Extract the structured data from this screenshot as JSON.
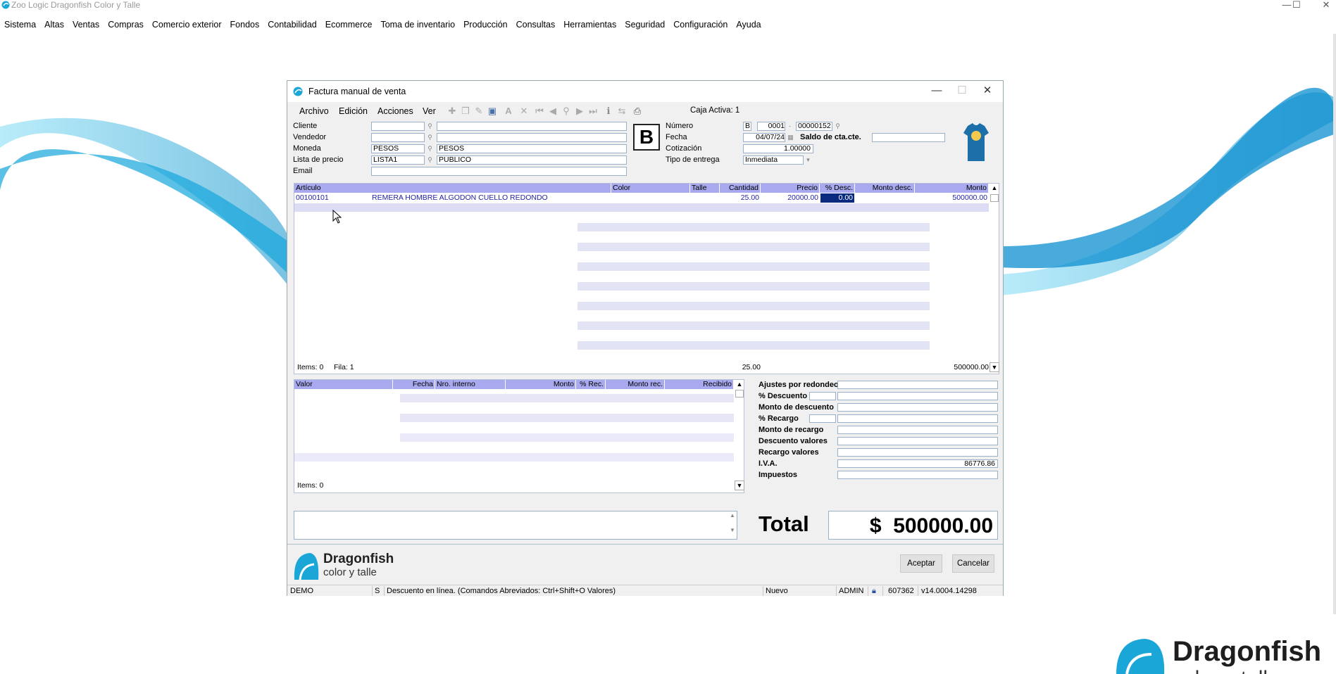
{
  "app": {
    "title": "Zoo Logic Dragonfish Color y Talle",
    "window_controls": {
      "minimize": "—",
      "maximize": "☐",
      "close": "✕"
    }
  },
  "menubar": [
    "Sistema",
    "Altas",
    "Ventas",
    "Compras",
    "Comercio exterior",
    "Fondos",
    "Contabilidad",
    "Ecommerce",
    "Toma de inventario",
    "Producción",
    "Consultas",
    "Herramientas",
    "Seguridad",
    "Configuración",
    "Ayuda"
  ],
  "brand": {
    "name": "Dragonfish",
    "tagline": "color y talle",
    "accent": "#1aa7d8"
  },
  "dialog": {
    "title": "Factura manual de venta",
    "controls": {
      "minimize": "—",
      "maximize": "☐",
      "close": "✕"
    },
    "toolbar": {
      "menus": [
        "Archivo",
        "Edición",
        "Acciones",
        "Ver"
      ],
      "caja_label": "Caja Activa: 1"
    },
    "header": {
      "cliente_label": "Cliente",
      "vendedor_label": "Vendedor",
      "moneda_label": "Moneda",
      "moneda_code": "PESOS",
      "moneda_desc": "PESOS",
      "lista_label": "Lista de precio",
      "lista_code": "LISTA1",
      "lista_desc": "PUBLICO",
      "email_label": "Email",
      "letter": "B",
      "numero_label": "Número",
      "numero_letter": "B",
      "numero_pv": "0001",
      "numero_nro": "00000152",
      "fecha_label": "Fecha",
      "fecha": "04/07/24",
      "saldo_label": "Saldo de cta.cte.",
      "cotizacion_label": "Cotización",
      "cotizacion": "1.00000",
      "tipo_entrega_label": "Tipo de entrega",
      "tipo_entrega": "Inmediata"
    },
    "items_grid": {
      "headers": [
        "Artículo",
        "Color",
        "Talle",
        "Cantidad",
        "Precio",
        "% Desc.",
        "Monto desc.",
        "Monto"
      ],
      "row": {
        "articulo": "00100101",
        "descripcion": "REMERA HOMBRE ALGODON CUELLO REDONDO",
        "color": "",
        "talle": "",
        "cantidad": "25.00",
        "precio": "20000.00",
        "desc": "0.00",
        "monto_desc": "",
        "monto": "500000.00"
      },
      "footer": {
        "items": "Items: 0",
        "fila": "Fila: 1",
        "total_cantidad": "25.00",
        "total_monto": "500000.00"
      }
    },
    "payments_grid": {
      "headers": [
        "Valor",
        "Fecha",
        "Nro. interno",
        "Monto",
        "% Rec.",
        "Monto rec.",
        "Recibido"
      ],
      "footer": {
        "items": "Items: 0"
      }
    },
    "totals": {
      "ajustes_label": "Ajustes por redondeo",
      "pct_descuento_label": "% Descuento",
      "monto_descuento_label": "Monto de descuento",
      "pct_recargo_label": "% Recargo",
      "monto_recargo_label": "Monto de recargo",
      "descuento_valores_label": "Descuento valores",
      "recargo_valores_label": "Recargo valores",
      "iva_label": "I.V.A.",
      "iva_value": "86776.86",
      "impuestos_label": "Impuestos",
      "total_label": "Total",
      "total_currency": "$",
      "total_value": "500000.00"
    },
    "buttons": {
      "accept": "Aceptar",
      "cancel": "Cancelar"
    },
    "statusbar": {
      "base": "DEMO",
      "flag": "S",
      "message": "Descuento en línea. (Comandos Abreviados: Ctrl+Shift+O Valores)",
      "state": "Nuevo",
      "user": "ADMIN",
      "code": "607362",
      "version": "v14.0004.14298"
    }
  }
}
